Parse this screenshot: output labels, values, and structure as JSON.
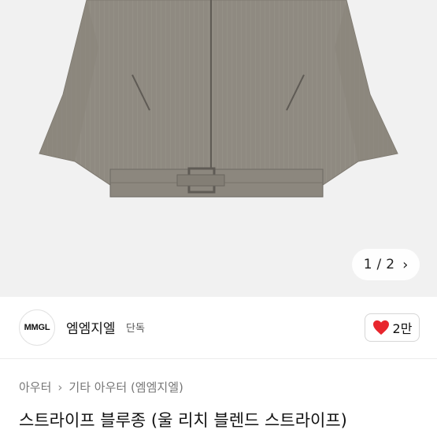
{
  "gallery": {
    "current": "1",
    "separator": "/",
    "total": "2",
    "next_icon": "chevron-right-icon"
  },
  "seller": {
    "logo_text": "MMGL",
    "name": "엠엠지엘",
    "badge": "단독"
  },
  "like": {
    "icon": "heart-icon",
    "count": "2만",
    "heart_color": "#e8262d"
  },
  "breadcrumb": {
    "items": [
      "아우터",
      "기타 아우터 (엠엠지엘)"
    ],
    "separator_icon": "chevron-right-icon"
  },
  "product": {
    "title": "스트라이프 블루종 (울 리치 블렌드 스트라이프)"
  }
}
